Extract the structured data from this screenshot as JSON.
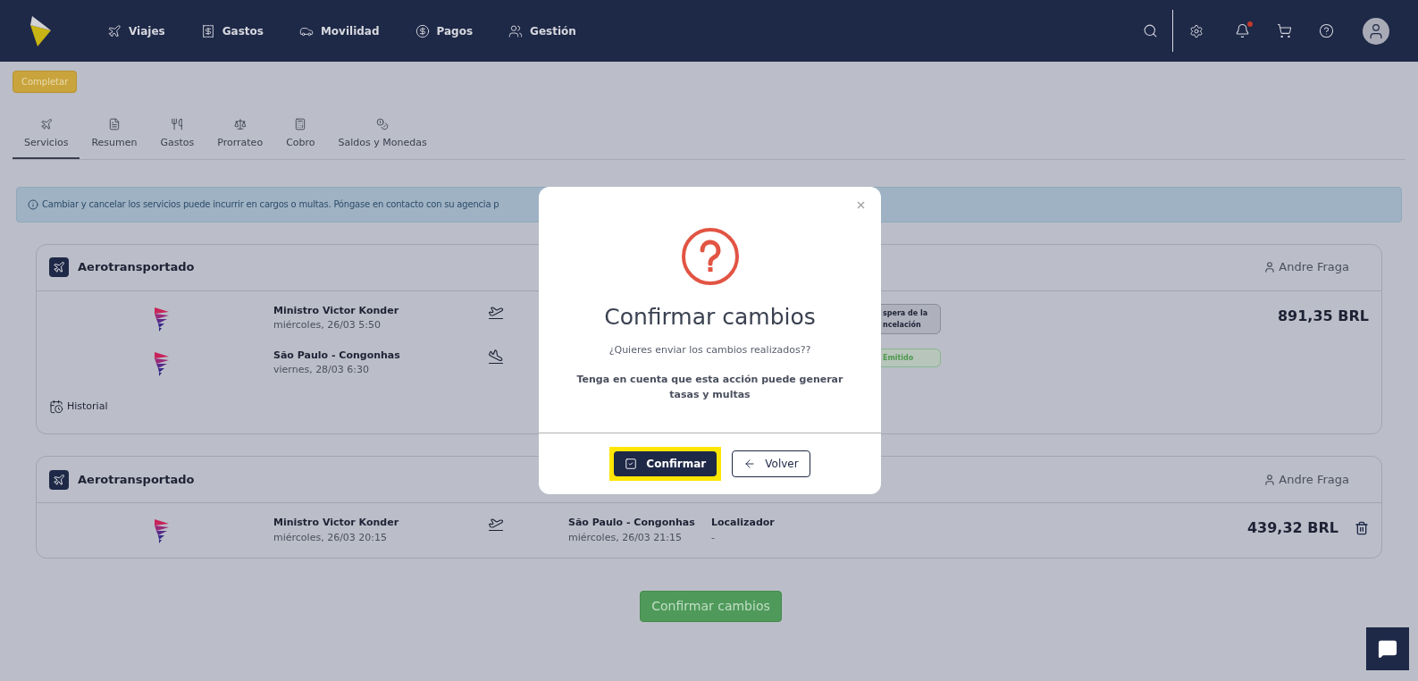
{
  "nav": {
    "items": [
      {
        "label": "Viajes",
        "kind": "plane"
      },
      {
        "label": "Gastos",
        "kind": "receipt"
      },
      {
        "label": "Movilidad",
        "kind": "car"
      },
      {
        "label": "Pagos",
        "kind": "dollar"
      },
      {
        "label": "Gestión",
        "kind": "users"
      }
    ],
    "notifications_unread": true
  },
  "complete_button": "Completar",
  "tabs": [
    {
      "label": "Servicios",
      "kind": "plane",
      "selected": true
    },
    {
      "label": "Resumen",
      "kind": "file",
      "selected": false
    },
    {
      "label": "Gastos",
      "kind": "utensils",
      "selected": false
    },
    {
      "label": "Prorrateo",
      "kind": "scale",
      "selected": false
    },
    {
      "label": "Cobro",
      "kind": "calculator",
      "selected": false
    },
    {
      "label": "Saldos y Monedas",
      "kind": "coins",
      "selected": false
    }
  ],
  "alert": "Cambiar y cancelar los servicios puede incurrir en cargos o multas. Póngase en contacto con su agencia p",
  "cards": [
    {
      "title": "Aerotransportado",
      "traveler": "Andre Fraga",
      "price": "891,35 BRL",
      "deletable": false,
      "history": "Historial",
      "segments": [
        {
          "origin": "Ministro Victor Konder",
          "origin_time": "miércoles, 26/03 5:50",
          "kind": "takeoff",
          "status": {
            "text": "spera de la ncelación",
            "kind": "pending"
          }
        },
        {
          "origin": "São Paulo - Congonhas",
          "origin_time": "viernes, 28/03 6:30",
          "kind": "landing",
          "status": {
            "text": "Emitido",
            "kind": "issued"
          }
        }
      ]
    },
    {
      "title": "Aerotransportado",
      "traveler": "Andre Fraga",
      "price": "439,32 BRL",
      "deletable": true,
      "segments": [
        {
          "origin": "Ministro Victor Konder",
          "origin_time": "miércoles, 26/03 20:15",
          "kind": "takeoff",
          "destination": "São Paulo - Congonhas",
          "destination_time": "miércoles, 26/03 21:15",
          "locator_label": "Localizador",
          "locator_value": "-"
        }
      ]
    }
  ],
  "submit_button": "Confirmar cambios",
  "modal": {
    "title": "Confirmar cambios",
    "question": "¿Quieres enviar los cambios realizados??",
    "warning": "Tenga en cuenta que esta acción puede generar tasas y multas",
    "confirm": "Confirmar",
    "confirm_highlighted": true,
    "back": "Volver"
  }
}
